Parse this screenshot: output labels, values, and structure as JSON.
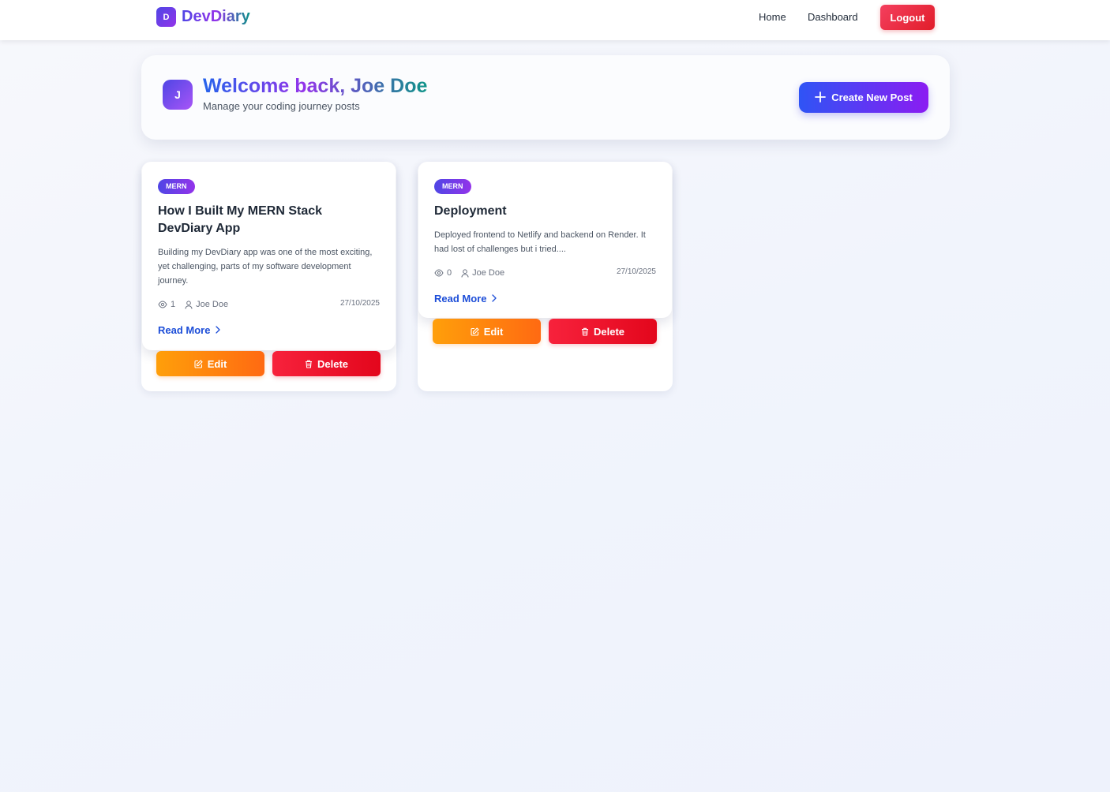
{
  "navbar": {
    "logo_letter": "D",
    "brand": "DevDiary",
    "links": [
      "Home",
      "Dashboard"
    ],
    "logout_label": "Logout"
  },
  "welcome": {
    "avatar_letter": "J",
    "title": "Welcome back, Joe Doe",
    "subtitle": "Manage your coding journey posts",
    "create_label": "Create New Post"
  },
  "posts": [
    {
      "tag": "MERN",
      "title": "How I Built My MERN Stack DevDiary App",
      "excerpt": "Building my DevDiary app was one of the most exciting, yet challenging, parts of my software development journey.",
      "views": "1",
      "author": "Joe Doe",
      "date": "27/10/2025",
      "read_more": "Read More",
      "edit_label": "Edit",
      "delete_label": "Delete"
    },
    {
      "tag": "MERN",
      "title": "Deployment",
      "excerpt": "Deployed frontend to Netlify and backend on Render. It had lost of challenges but i tried....",
      "views": "0",
      "author": "Joe Doe",
      "date": "27/10/2025",
      "read_more": "Read More",
      "edit_label": "Edit",
      "delete_label": "Delete"
    }
  ],
  "colors": {
    "brand_gradient_start": "#4f46e5",
    "brand_gradient_end": "#9333ea",
    "link_blue": "#1d4ed8",
    "edit_orange": "#ff8a0a",
    "delete_red": "#e3061c"
  },
  "icons": {
    "create": "plus-icon",
    "views": "eye-icon",
    "author": "user-icon",
    "read_more": "chevron-right-icon",
    "edit": "edit-icon",
    "delete": "trash-icon"
  }
}
